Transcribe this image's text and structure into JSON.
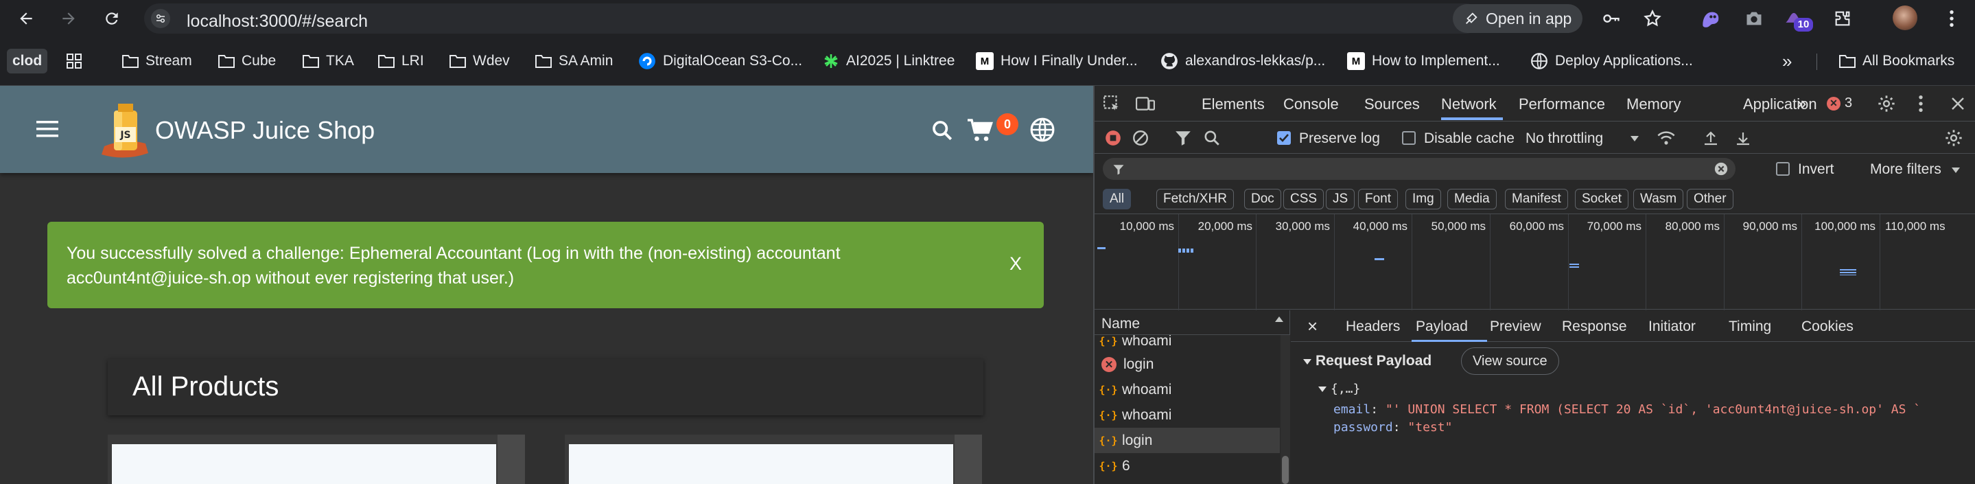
{
  "browser": {
    "url": "localhost:3000/#/search",
    "open_in_app": "Open in app",
    "extensions_badge": "10"
  },
  "bookmarks": {
    "profile": "clod",
    "items": [
      {
        "label": "Stream",
        "icon": "folder-icon"
      },
      {
        "label": "Cube",
        "icon": "folder-icon"
      },
      {
        "label": "TKA",
        "icon": "folder-icon"
      },
      {
        "label": "LRI",
        "icon": "folder-icon"
      },
      {
        "label": "Wdev",
        "icon": "folder-icon"
      },
      {
        "label": "SA Amin",
        "icon": "folder-icon"
      },
      {
        "label": "DigitalOcean S3-Co...",
        "icon": "digitalocean-icon"
      },
      {
        "label": "AI2025 | Linktree",
        "icon": "linktree-icon"
      },
      {
        "label": "How I Finally Under...",
        "icon": "medium-icon"
      },
      {
        "label": "alexandros-lekkas/p...",
        "icon": "github-icon"
      },
      {
        "label": "How to Implement...",
        "icon": "medium-icon"
      },
      {
        "label": "Deploy Applications...",
        "icon": "globe-icon"
      }
    ],
    "more": "»",
    "all_bookmarks": "All Bookmarks"
  },
  "app": {
    "title": "OWASP Juice Shop",
    "cart_count": "0",
    "success_message": "You successfully solved a challenge: Ephemeral Accountant (Log in with the (non-existing) accountant acc0unt4nt@juice-sh.op without ever registering that user.)",
    "success_close": "X",
    "products_heading": "All Products",
    "colors": {
      "toolbar": "#546e7a",
      "success": "#689f38",
      "badge": "#ff5722"
    }
  },
  "devtools": {
    "tabs": [
      "Elements",
      "Console",
      "Sources",
      "Network",
      "Performance",
      "Memory",
      "Application"
    ],
    "active_tab": "Network",
    "more_tabs": "»",
    "error_count": "3",
    "toolbar": {
      "preserve_log": "Preserve log",
      "disable_cache": "Disable cache",
      "throttling": "No throttling"
    },
    "filter": {
      "invert": "Invert",
      "more_filters": "More filters"
    },
    "types": [
      "All",
      "Fetch/XHR",
      "Doc",
      "CSS",
      "JS",
      "Font",
      "Img",
      "Media",
      "Manifest",
      "Socket",
      "Wasm",
      "Other"
    ],
    "timeline_ticks": [
      "10,000 ms",
      "20,000 ms",
      "30,000 ms",
      "40,000 ms",
      "50,000 ms",
      "60,000 ms",
      "70,000 ms",
      "80,000 ms",
      "90,000 ms",
      "100,000 ms",
      "110,000 ms"
    ],
    "requests": {
      "header": "Name",
      "rows": [
        {
          "name": "whoami",
          "type": "xhr"
        },
        {
          "name": "login",
          "type": "error"
        },
        {
          "name": "whoami",
          "type": "xhr"
        },
        {
          "name": "whoami",
          "type": "xhr"
        },
        {
          "name": "login",
          "type": "xhr"
        },
        {
          "name": "6",
          "type": "xhr"
        }
      ]
    },
    "detail": {
      "close": "×",
      "tabs": [
        "Headers",
        "Payload",
        "Preview",
        "Response",
        "Initiator",
        "Timing",
        "Cookies"
      ],
      "active_tab": "Payload",
      "section": "Request Payload",
      "view_source": "View source",
      "object_summary": "{,…}",
      "email_key": "email",
      "email_value": "\"' UNION SELECT * FROM (SELECT 20 AS `id`, 'acc0unt4nt@juice-sh.op' AS `",
      "password_key": "password",
      "password_value": "\"test\""
    }
  }
}
